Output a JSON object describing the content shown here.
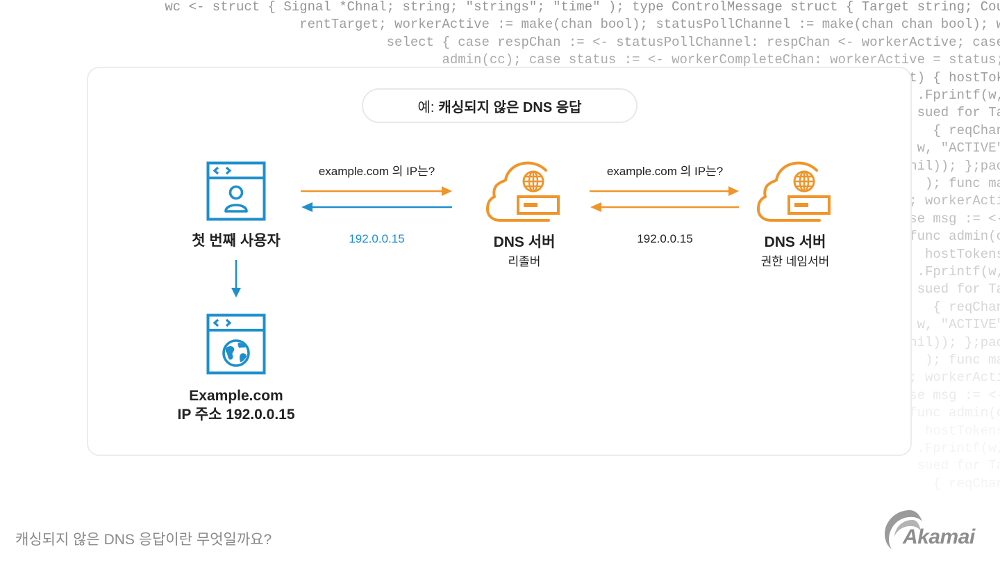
{
  "background_code": [
    "wc <- struct { Signal *Chnal; string; \"strings\"; \"time\" ); type ControlMessage struct { Target string; Cou",
    "rentTarget; workerActive := make(chan bool); statusPollChannel := make(chan chan bool); w",
    "select { case respChan := <- statusPollChannel: respChan <- workerActive; case",
    "admin(cc); case status := <- workerCompleteChan: workerActive = status;",
    "t) { hostTok",
    ".Fprintf(w,",
    "sued for Ta",
    " { reqChan",
    "w, \"ACTIVE\"",
    "nil)); };pac",
    " ); func ma",
    "; workerActi",
    "se msg := <-",
    "func admin(c",
    "hostTokens",
    ".Fprintf(w,",
    "sued for Ta",
    " { reqChan",
    "w, \"ACTIVE\"",
    "nil)); };pac",
    " ); func ma",
    "; workerActi",
    "se msg := <-",
    "func admin(c",
    "hostTokens",
    ".Fprintf(w,",
    "sued for Ta",
    " { reqChan"
  ],
  "diagram": {
    "title_prefix": "예:",
    "title_main": "캐싱되지 않은 DNS 응답",
    "nodes": {
      "user": {
        "label": "첫 번째 사용자",
        "icon": "browser-user-icon"
      },
      "resolver": {
        "label": "DNS 서버",
        "sublabel": "리졸버",
        "icon": "cloud-dns-server-icon"
      },
      "authoritative": {
        "label": "DNS 서버",
        "sublabel": "권한 네임서버",
        "icon": "cloud-dns-server-icon"
      },
      "website": {
        "label_line1": "Example.com",
        "label_line2": "IP 주소 192.0.0.15",
        "icon": "browser-globe-icon"
      }
    },
    "edges": [
      {
        "from": "user",
        "to": "resolver",
        "label": "example.com 의 IP는?",
        "color": "#F0952A"
      },
      {
        "from": "resolver",
        "to": "user",
        "label": "192.0.0.15",
        "color": "#1E8FCC"
      },
      {
        "from": "resolver",
        "to": "authoritative",
        "label": "example.com 의 IP는?",
        "color": "#F0952A"
      },
      {
        "from": "authoritative",
        "to": "resolver",
        "label": "192.0.0.15",
        "color": "#F0952A"
      },
      {
        "from": "user",
        "to": "website",
        "label": "",
        "color": "#1E8FCC"
      }
    ]
  },
  "colors": {
    "orange": "#F0952A",
    "blue": "#1E8FCC",
    "text": "#222222",
    "muted": "#8A8A8A"
  },
  "footer": {
    "question": "캐싱되지 않은 DNS 응답이란 무엇일까요?",
    "brand": "Akamai"
  }
}
